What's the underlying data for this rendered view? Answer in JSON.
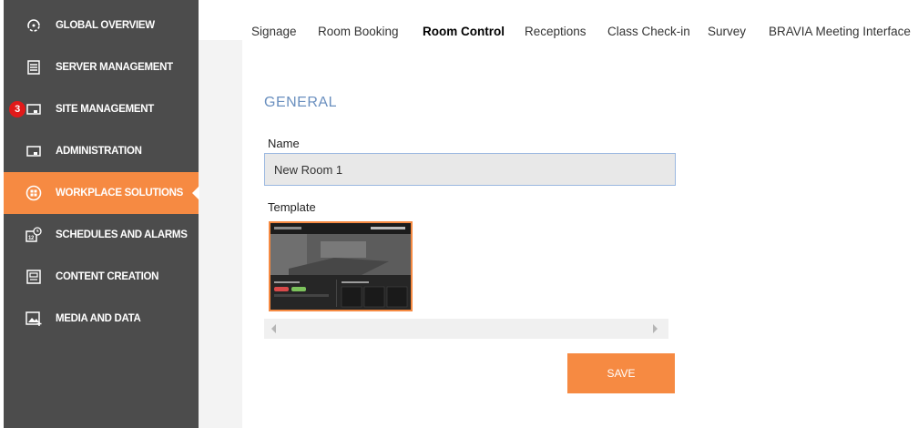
{
  "sidebar": {
    "items": [
      {
        "label": "GLOBAL OVERVIEW",
        "icon": "global-overview-icon",
        "active": false
      },
      {
        "label": "SERVER MANAGEMENT",
        "icon": "server-icon",
        "active": false
      },
      {
        "label": "SITE MANAGEMENT",
        "icon": "site-icon",
        "active": false,
        "badge": "3"
      },
      {
        "label": "ADMINISTRATION",
        "icon": "administration-icon",
        "active": false
      },
      {
        "label": "WORKPLACE SOLUTIONS",
        "icon": "workplace-icon",
        "active": true
      },
      {
        "label": "SCHEDULES AND ALARMS",
        "icon": "calendar-clock-icon",
        "active": false
      },
      {
        "label": "CONTENT CREATION",
        "icon": "content-creation-icon",
        "active": false
      },
      {
        "label": "MEDIA AND DATA",
        "icon": "media-icon",
        "active": false
      }
    ]
  },
  "tabs": [
    {
      "label": "Signage",
      "active": false
    },
    {
      "label": "Room Booking",
      "active": false
    },
    {
      "label": "Room Control",
      "active": true
    },
    {
      "label": "Receptions",
      "active": false
    },
    {
      "label": "Class Check-in",
      "active": false
    },
    {
      "label": "Survey",
      "active": false
    },
    {
      "label": "BRAVIA Meeting Interface",
      "active": false
    }
  ],
  "main": {
    "section_title": "GENERAL",
    "name_label": "Name",
    "name_value": "New Room 1",
    "template_label": "Template",
    "save_label": "SAVE"
  },
  "colors": {
    "accent": "#f68a42",
    "sidebar_bg": "#4c4c4c",
    "title_blue": "#6a8fbf",
    "badge_red": "#e01a1a"
  }
}
